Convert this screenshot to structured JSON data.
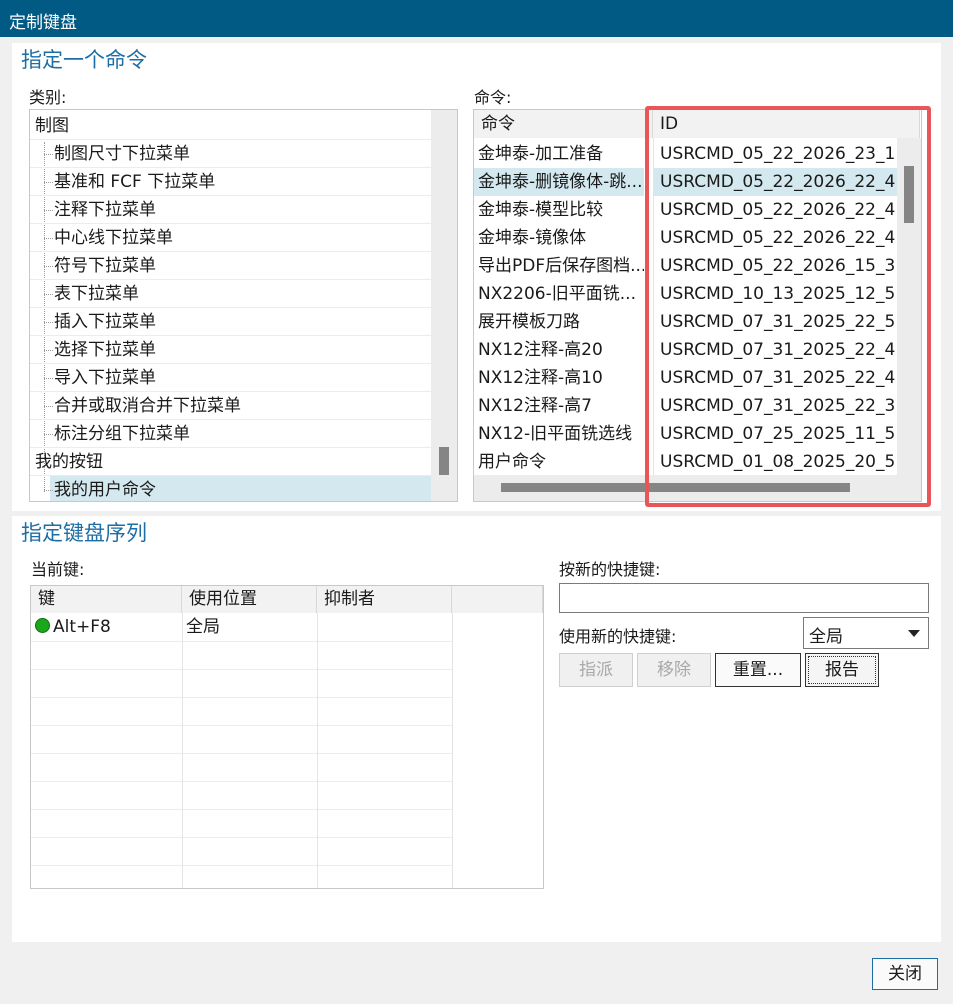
{
  "window": {
    "title": "定制键盘"
  },
  "assign_command": {
    "title": "指定一个命令",
    "category_label": "类别:",
    "command_label": "命令:",
    "categories": [
      {
        "label": "制图",
        "level": 0,
        "selected": false
      },
      {
        "label": "制图尺寸下拉菜单",
        "level": 1,
        "selected": false
      },
      {
        "label": "基准和 FCF 下拉菜单",
        "level": 1,
        "selected": false
      },
      {
        "label": "注释下拉菜单",
        "level": 1,
        "selected": false
      },
      {
        "label": "中心线下拉菜单",
        "level": 1,
        "selected": false
      },
      {
        "label": "符号下拉菜单",
        "level": 1,
        "selected": false
      },
      {
        "label": "表下拉菜单",
        "level": 1,
        "selected": false
      },
      {
        "label": "插入下拉菜单",
        "level": 1,
        "selected": false
      },
      {
        "label": "选择下拉菜单",
        "level": 1,
        "selected": false
      },
      {
        "label": "导入下拉菜单",
        "level": 1,
        "selected": false
      },
      {
        "label": "合并或取消合并下拉菜单",
        "level": 1,
        "selected": false
      },
      {
        "label": "标注分组下拉菜单",
        "level": 1,
        "selected": false
      },
      {
        "label": "我的按钮",
        "level": 0,
        "selected": false
      },
      {
        "label": "我的用户命令",
        "level": 1,
        "selected": true
      }
    ],
    "command_columns": [
      "命令",
      "ID"
    ],
    "commands": [
      {
        "name": "金坤泰-加工准备",
        "id": "USRCMD_05_22_2026_23_1",
        "selected": false
      },
      {
        "name": "金坤泰-删镜像体-跳...",
        "id": "USRCMD_05_22_2026_22_4",
        "selected": true
      },
      {
        "name": "金坤泰-模型比较",
        "id": "USRCMD_05_22_2026_22_4",
        "selected": false
      },
      {
        "name": "金坤泰-镜像体",
        "id": "USRCMD_05_22_2026_22_4",
        "selected": false
      },
      {
        "name": "导出PDF后保存图档...",
        "id": "USRCMD_05_22_2026_15_3",
        "selected": false
      },
      {
        "name": "NX2206-旧平面铣...",
        "id": "USRCMD_10_13_2025_12_5",
        "selected": false
      },
      {
        "name": "展开模板刀路",
        "id": "USRCMD_07_31_2025_22_5",
        "selected": false
      },
      {
        "name": "NX12注释-高20",
        "id": "USRCMD_07_31_2025_22_4",
        "selected": false
      },
      {
        "name": "NX12注释-高10",
        "id": "USRCMD_07_31_2025_22_4",
        "selected": false
      },
      {
        "name": "NX12注释-高7",
        "id": "USRCMD_07_31_2025_22_3",
        "selected": false
      },
      {
        "name": "NX12-旧平面铣选线",
        "id": "USRCMD_07_25_2025_11_5",
        "selected": false
      },
      {
        "name": "用户命令",
        "id": "USRCMD_01_08_2025_20_5",
        "selected": false
      }
    ]
  },
  "key_sequence": {
    "title": "指定键盘序列",
    "current_keys_label": "当前键:",
    "columns": [
      "键",
      "使用位置",
      "抑制者"
    ],
    "rows": [
      {
        "key": "Alt+F8",
        "location": "全局",
        "suppressed_by": "",
        "status_color": "#1aa81a"
      }
    ],
    "new_shortcut_label": "按新的快捷键:",
    "new_shortcut_value": "",
    "use_new_shortcut_label": "使用新的快捷键:",
    "scope_selected": "全局",
    "buttons": {
      "assign": "指派",
      "remove": "移除",
      "reset": "重置...",
      "report": "报告"
    }
  },
  "footer": {
    "close": "关闭"
  }
}
